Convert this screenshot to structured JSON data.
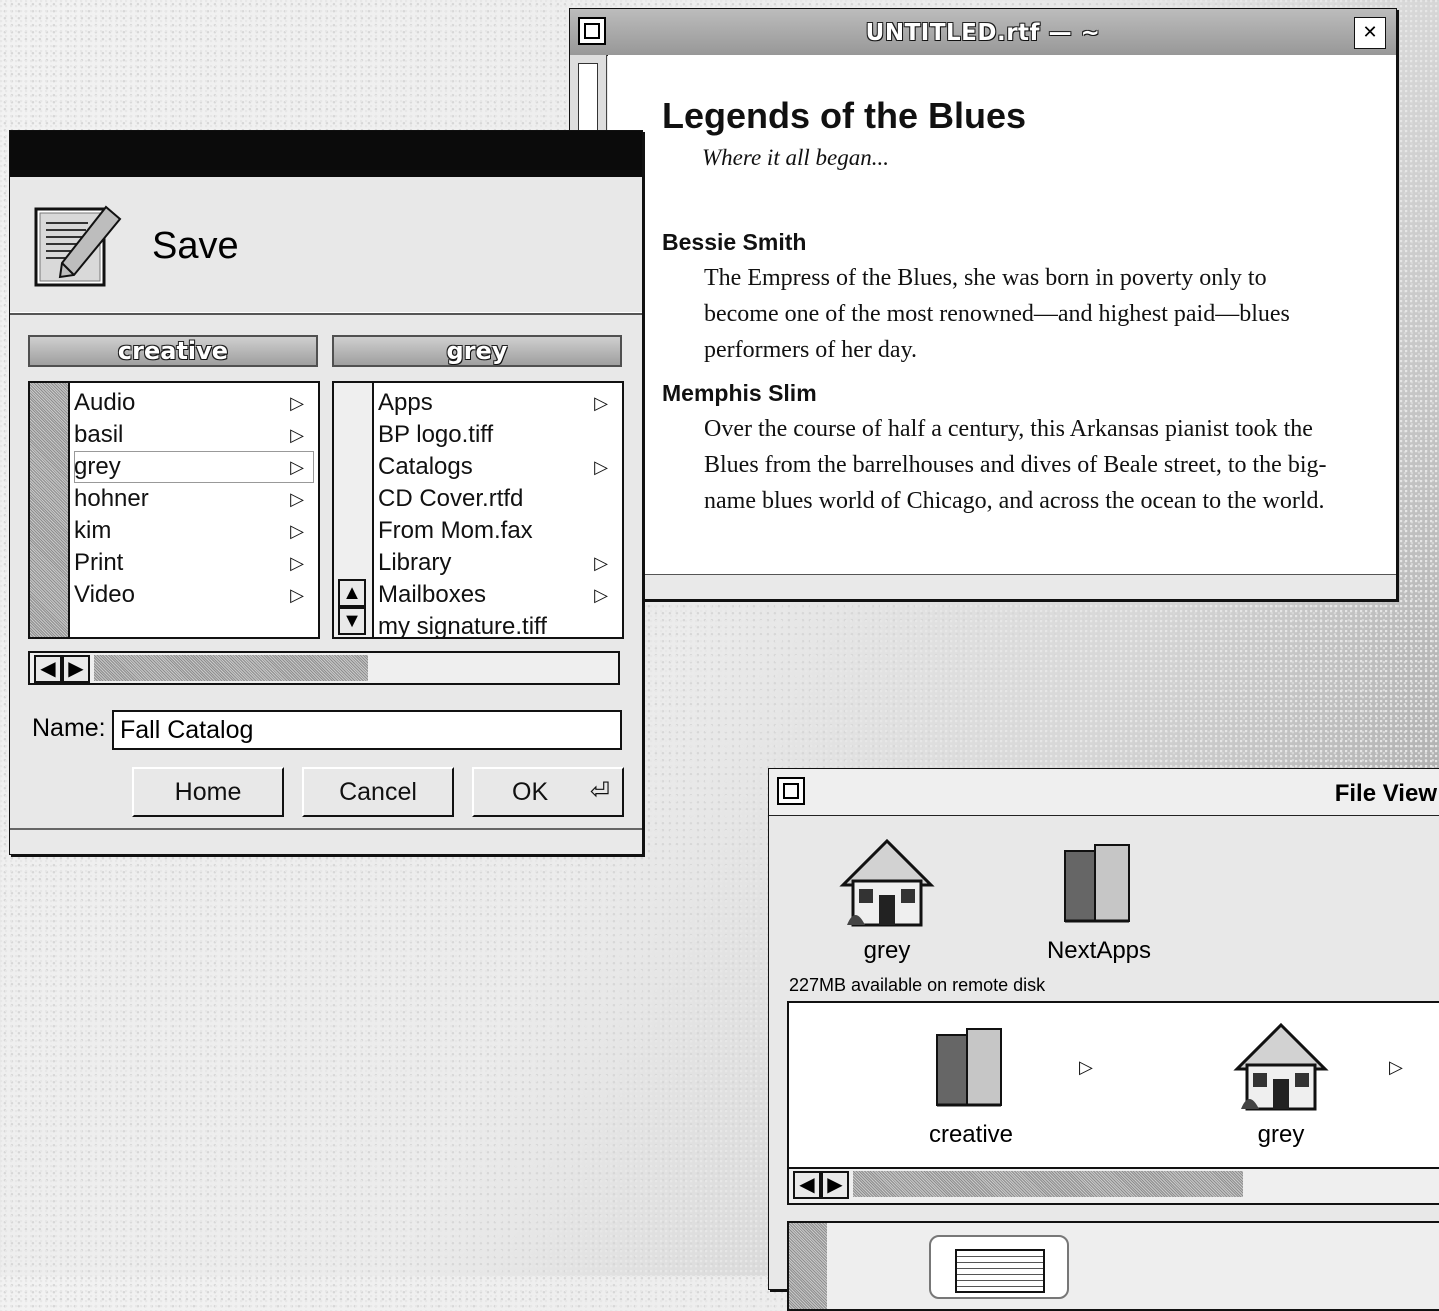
{
  "document_window": {
    "title": "UNTITLED.rtf — ~",
    "heading": "Legends of the Blues",
    "subtitle": "Where it all began...",
    "sections": [
      {
        "name": "Bessie Smith",
        "text": "The Empress of the Blues, she was born in poverty only to become one of the most renowned—and highest paid—blues performers of her day."
      },
      {
        "name": "Memphis Slim",
        "text": "Over the course of half a century, this Arkansas pianist took the Blues from the barrelhouses and dives of Beale street, to the big-name blues world of Chicago, and across the ocean to the world."
      }
    ]
  },
  "save_panel": {
    "title": "Save",
    "columns": [
      {
        "header": "creative",
        "items": [
          {
            "label": "Audio",
            "has_arrow": true
          },
          {
            "label": "basil",
            "has_arrow": true
          },
          {
            "label": "grey",
            "has_arrow": true,
            "selected": true
          },
          {
            "label": "hohner",
            "has_arrow": true
          },
          {
            "label": "kim",
            "has_arrow": true
          },
          {
            "label": "Print",
            "has_arrow": true
          },
          {
            "label": "Video",
            "has_arrow": true
          }
        ]
      },
      {
        "header": "grey",
        "items": [
          {
            "label": "Apps",
            "has_arrow": true
          },
          {
            "label": "BP logo.tiff",
            "has_arrow": false
          },
          {
            "label": "Catalogs",
            "has_arrow": true
          },
          {
            "label": "CD Cover.rtfd",
            "has_arrow": false
          },
          {
            "label": "From Mom.fax",
            "has_arrow": false
          },
          {
            "label": "Library",
            "has_arrow": true
          },
          {
            "label": "Mailboxes",
            "has_arrow": true
          },
          {
            "label": "my signature.tiff",
            "has_arrow": false
          }
        ]
      }
    ],
    "name_label": "Name:",
    "name_value": "Fall Catalog",
    "buttons": {
      "home": "Home",
      "cancel": "Cancel",
      "ok": "OK"
    }
  },
  "file_viewer": {
    "title": "File View",
    "shelf_items": [
      {
        "label": "grey",
        "icon": "house-icon"
      },
      {
        "label": "NextApps",
        "icon": "folder-icon"
      }
    ],
    "available_text": "227MB available on remote disk",
    "browser_items": [
      {
        "label": "creative",
        "icon": "folder-icon"
      },
      {
        "label": "grey",
        "icon": "house-icon"
      }
    ]
  }
}
